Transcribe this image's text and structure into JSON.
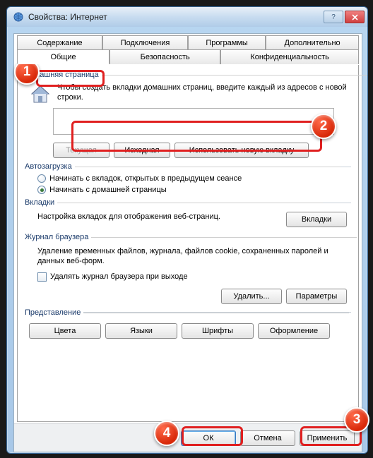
{
  "window": {
    "title": "Свойства: Интернет"
  },
  "tabs": {
    "row1": [
      "Содержание",
      "Подключения",
      "Программы",
      "Дополнительно"
    ],
    "row2": [
      "Общие",
      "Безопасность",
      "Конфиденциальность"
    ],
    "active": "Общие"
  },
  "home": {
    "group": "Домашняя страница",
    "desc": "Чтобы создать вкладки домашних страниц, введите каждый из адресов с новой строки.",
    "value": "",
    "btn_current": "Текущая",
    "btn_default": "Исходная",
    "btn_newtab": "Использовать новую вкладку"
  },
  "startup": {
    "group": "Автозагрузка",
    "opt1": "Начинать с вкладок, открытых в предыдущем сеансе",
    "opt2": "Начинать с домашней страницы"
  },
  "tabs_group": {
    "group": "Вкладки",
    "desc": "Настройка вкладок для отображения веб-страниц.",
    "btn": "Вкладки"
  },
  "history": {
    "group": "Журнал браузера",
    "desc": "Удаление временных файлов, журнала, файлов cookie, сохраненных паролей и данных веб-форм.",
    "check": "Удалять журнал браузера при выходе",
    "btn_delete": "Удалить...",
    "btn_params": "Параметры"
  },
  "appearance": {
    "group": "Представление",
    "btn_colors": "Цвета",
    "btn_lang": "Языки",
    "btn_fonts": "Шрифты",
    "btn_access": "Оформление"
  },
  "bottom": {
    "ok": "ОК",
    "cancel": "Отмена",
    "apply": "Применить"
  },
  "badges": {
    "b1": "1",
    "b2": "2",
    "b3": "3",
    "b4": "4"
  }
}
